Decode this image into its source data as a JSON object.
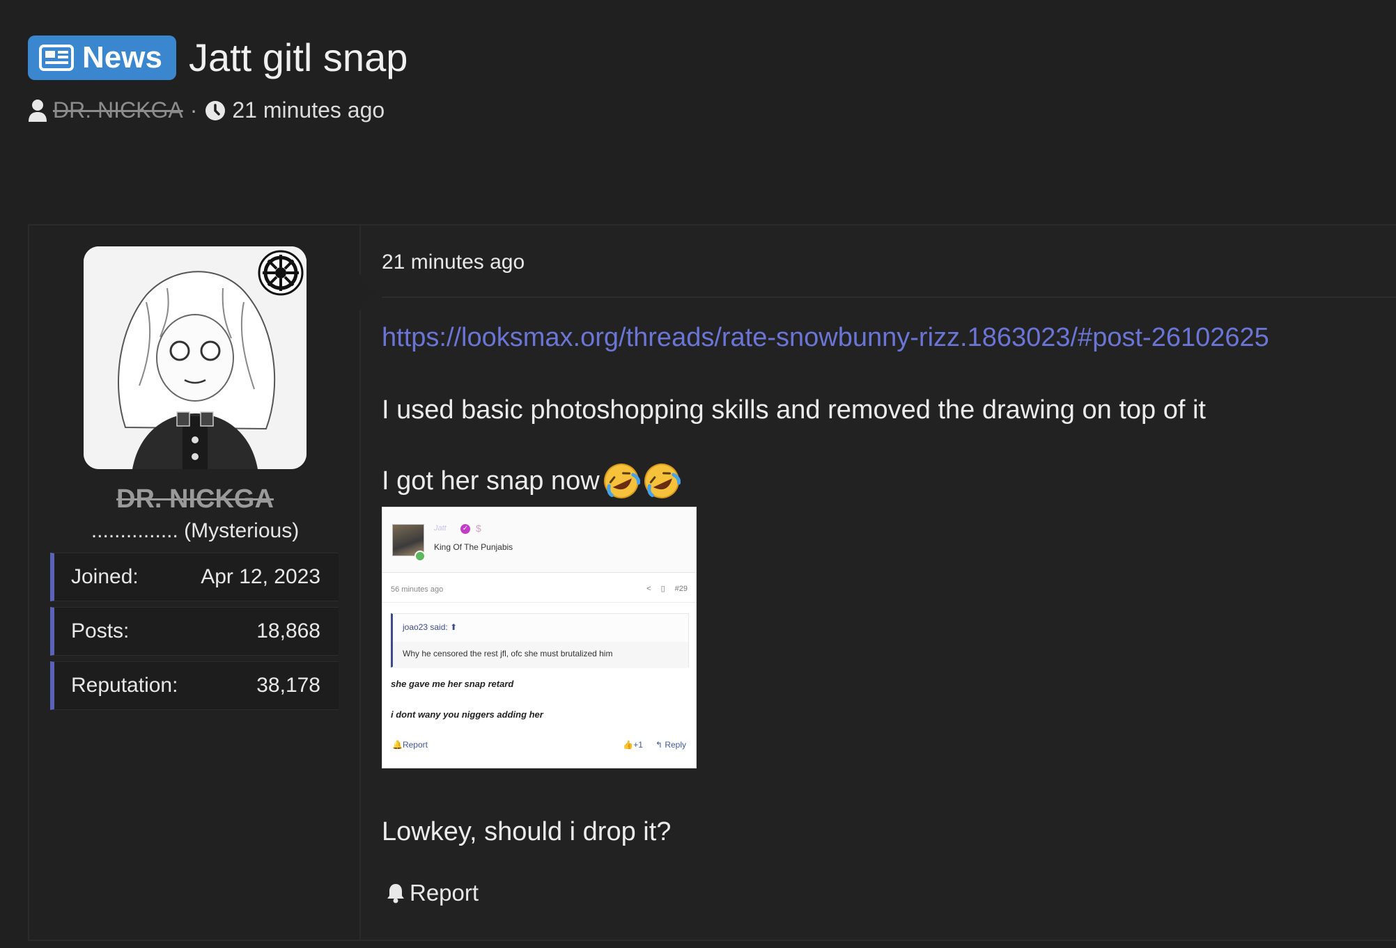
{
  "thread": {
    "prefix": "News",
    "title": "Jatt gitl snap",
    "author": "DR. NICKGA",
    "time": "21 minutes ago"
  },
  "user": {
    "name": "DR. NICKGA",
    "title": "............... (Mysterious)",
    "stats": [
      {
        "label": "Joined:",
        "value": "Apr 12, 2023"
      },
      {
        "label": "Posts:",
        "value": "18,868"
      },
      {
        "label": "Reputation:",
        "value": "38,178"
      }
    ]
  },
  "post": {
    "time": "21 minutes ago",
    "link": "https://looksmax.org/threads/rate-snowbunny-rizz.1863023/#post-26102625",
    "line1": "I used basic photoshopping skills and removed the drawing on top of it",
    "line2": "I got her snap now",
    "line3": "Lowkey, should i drop it?",
    "report": "Report"
  },
  "embed": {
    "user_name": "Jatt",
    "user_title": "King Of The Punjabis",
    "time": "56 minutes ago",
    "post_number": "#29",
    "quote_author": "joao23 said:",
    "quote_text": "Why he censored the rest jfl, ofc she must brutalized him",
    "line1": "she gave me her snap retard",
    "line2": "i dont wany you niggers adding her",
    "report": "Report",
    "likes": "+1",
    "reply": "Reply"
  },
  "colors": {
    "background": "#202020",
    "prefix_badge": "#3a86cf",
    "link": "#6b75d6",
    "stat_accent": "#5a63b8"
  }
}
